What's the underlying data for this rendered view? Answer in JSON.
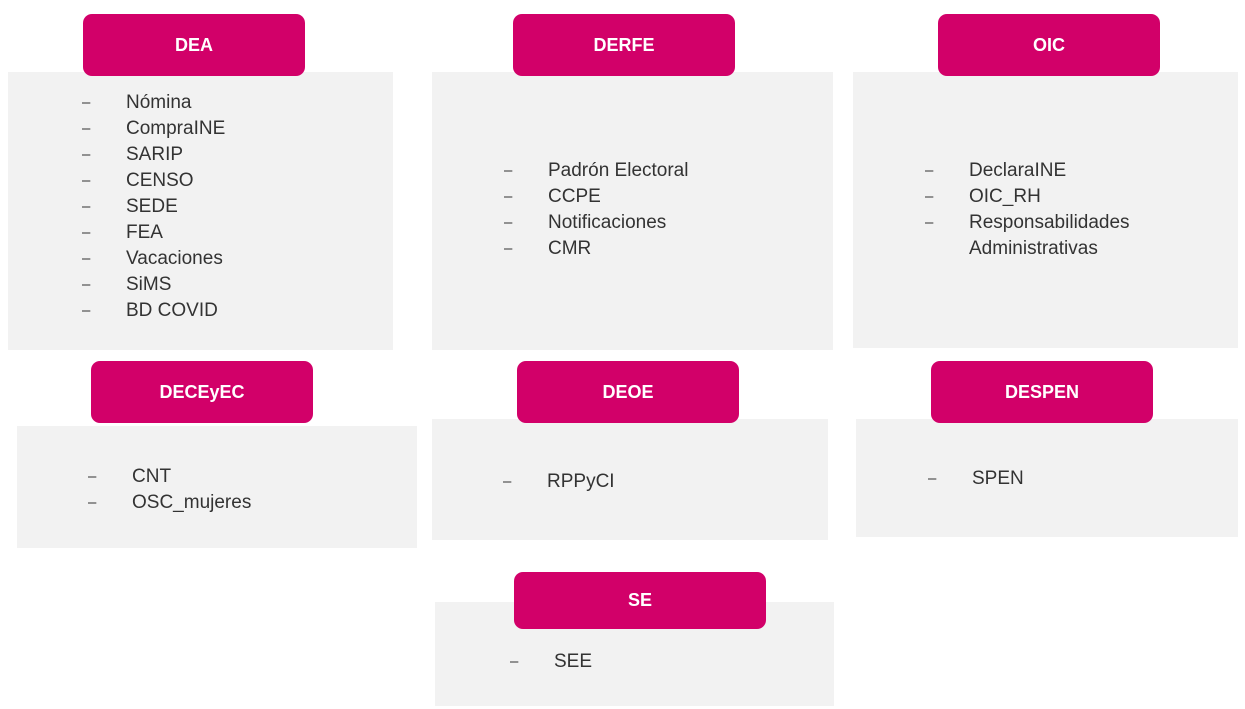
{
  "groups": [
    {
      "id": "dea",
      "title": "DEA",
      "items": [
        "Nómina",
        "CompraINE",
        "SARIP",
        "CENSO",
        "SEDE",
        "FEA",
        "Vacaciones",
        "SiMS",
        "BD COVID"
      ]
    },
    {
      "id": "derfe",
      "title": "DERFE",
      "items": [
        "Padrón Electoral",
        "CCPE",
        "Notificaciones",
        "CMR"
      ]
    },
    {
      "id": "oic",
      "title": "OIC",
      "items": [
        "DeclaraINE",
        "OIC_RH",
        "Responsabilidades",
        "Administrativas"
      ]
    },
    {
      "id": "deceyec",
      "title": "DECEyEC",
      "items": [
        "CNT",
        "OSC_mujeres"
      ]
    },
    {
      "id": "deoe",
      "title": "DEOE",
      "items": [
        "RPPyCI"
      ]
    },
    {
      "id": "despen",
      "title": "DESPEN",
      "items": [
        "SPEN"
      ]
    },
    {
      "id": "se",
      "title": "SE",
      "items": [
        "SEE"
      ]
    }
  ],
  "dash_symbol": "–",
  "colors": {
    "label_bg": "#d20069",
    "label_text": "#ffffff",
    "box_bg": "#f2f2f2",
    "text": "#333333"
  }
}
